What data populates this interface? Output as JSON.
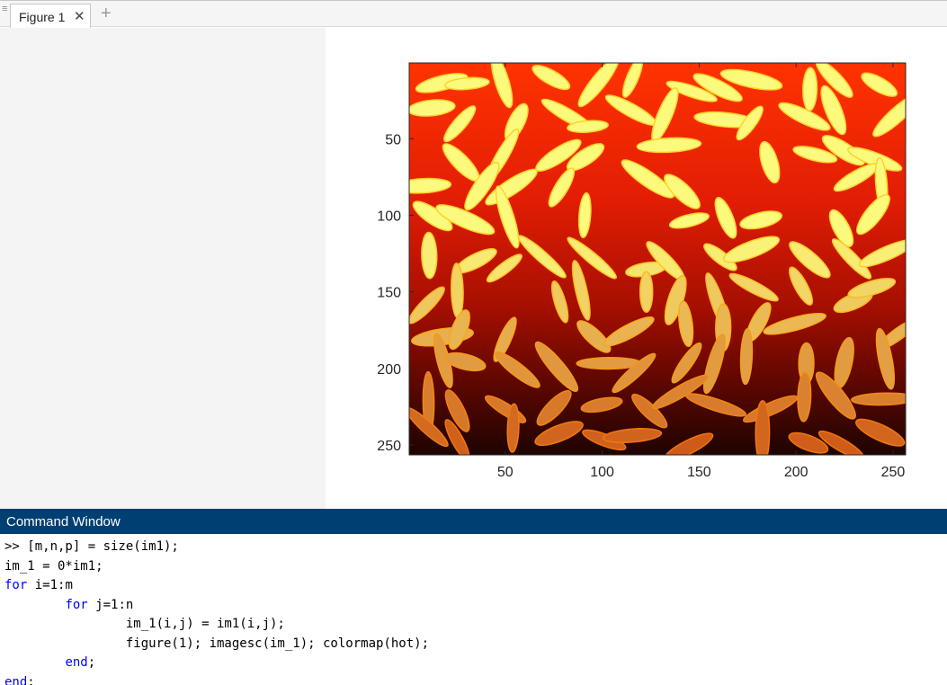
{
  "tabs": [
    {
      "label": "Figure 1",
      "close_icon": "close-icon"
    }
  ],
  "add_tab_icon": "plus-icon",
  "figure": {
    "image_colormap": "hot",
    "x_ticks": [
      "50",
      "100",
      "150",
      "200",
      "250"
    ],
    "y_ticks": [
      "50",
      "100",
      "150",
      "200",
      "250"
    ],
    "xlim": [
      0.5,
      256.5
    ],
    "ylim": [
      0.5,
      256.5
    ],
    "x_tick_values": [
      50,
      100,
      150,
      200,
      250
    ],
    "y_tick_values": [
      50,
      100,
      150,
      200,
      250
    ],
    "colors": {
      "background_top": "#e52a06",
      "background_bottom": "#1e0400",
      "grain_light": "#fffb7a",
      "grain_dark": "#ff7a12"
    }
  },
  "command_window": {
    "title": "Command Window",
    "lines": [
      {
        "kw": "",
        "text": ">> [m,n,p] = size(im1);"
      },
      {
        "kw": "",
        "text": "im_1 = 0*im1;"
      },
      {
        "kw": "for",
        "text": " i=1:m"
      },
      {
        "kw": "        for",
        "text": " j=1:n"
      },
      {
        "kw": "",
        "text": "                im_1(i,j) = im1(i,j);"
      },
      {
        "kw": "",
        "text": "                figure(1); imagesc(im_1); colormap(hot);"
      },
      {
        "kw": "        end",
        "text": ";"
      },
      {
        "kw": "end",
        "text": ";"
      }
    ]
  }
}
